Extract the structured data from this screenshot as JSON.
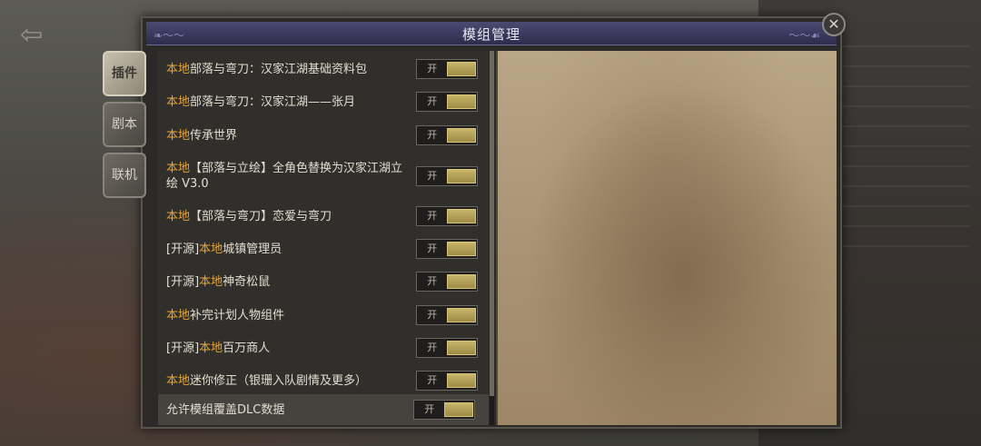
{
  "dialog": {
    "title": "模组管理",
    "close_icon": "close-icon"
  },
  "tabs": [
    {
      "label": "插件",
      "active": true
    },
    {
      "label": "剧本",
      "active": false
    },
    {
      "label": "联机",
      "active": false
    }
  ],
  "toggle_on_label": "开",
  "mods": [
    {
      "source": "",
      "local": "本地",
      "name": "部落与弯刀：汉家江湖基础资料包",
      "state": "开"
    },
    {
      "source": "",
      "local": "本地",
      "name": "部落与弯刀：汉家江湖——张月",
      "state": "开"
    },
    {
      "source": "",
      "local": "本地",
      "name": "传承世界",
      "state": "开"
    },
    {
      "source": "",
      "local": "本地",
      "name": "【部落与立绘】全角色替换为汉家江湖立绘 V3.0",
      "state": "开"
    },
    {
      "source": "",
      "local": "本地",
      "name": "【部落与弯刀】恋爱与弯刀",
      "state": "开"
    },
    {
      "source": "[开源]",
      "local": "本地",
      "name": "城镇管理员",
      "state": "开"
    },
    {
      "source": "[开源]",
      "local": "本地",
      "name": "神奇松鼠",
      "state": "开"
    },
    {
      "source": "",
      "local": "本地",
      "name": "补完计划人物组件",
      "state": "开"
    },
    {
      "source": "[开源]",
      "local": "本地",
      "name": "百万商人",
      "state": "开"
    },
    {
      "source": "",
      "local": "本地",
      "name": "迷你修正（银珊入队剧情及更多）",
      "state": "开"
    }
  ],
  "dlc_row": {
    "label": "允许模组覆盖DLC数据",
    "state": "开"
  },
  "colors": {
    "local_tag": "#e7a53a",
    "toggle_knob": "#c8b46a",
    "title_bar": "#3c3a5f"
  }
}
